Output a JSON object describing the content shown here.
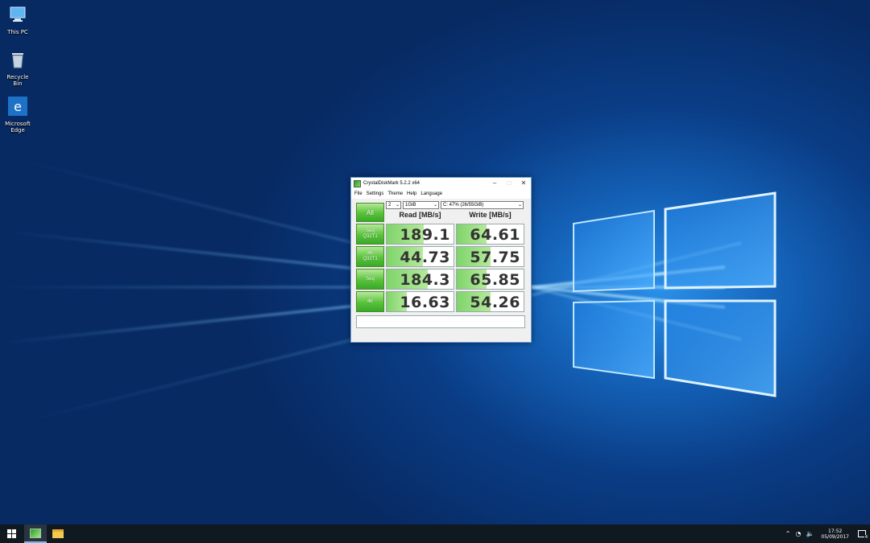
{
  "desktop": {
    "icons": [
      {
        "label": "This PC",
        "icon": "computer-icon"
      },
      {
        "label": "Recycle Bin",
        "icon": "recycle-bin-icon"
      },
      {
        "label": "Microsoft Edge",
        "icon": "edge-icon"
      }
    ]
  },
  "window": {
    "title": "CrystalDiskMark 5.2.2 x64",
    "menu": [
      "File",
      "Settings",
      "Theme",
      "Help",
      "Language"
    ],
    "controls": {
      "count": "2",
      "size": "1GiB",
      "drive": "C: 47% (26/55GiB)"
    },
    "all_button": "All",
    "headers": {
      "read": "Read [MB/s]",
      "write": "Write [MB/s]"
    },
    "rows": [
      {
        "label_line1": "Seq",
        "label_line2": "Q32T1",
        "read": "189.1",
        "write": "64.61",
        "read_fill": 0.55,
        "write_fill": 0.45
      },
      {
        "label_line1": "4K",
        "label_line2": "Q32T1",
        "read": "44.73",
        "write": "57.75",
        "read_fill": 0.54,
        "write_fill": 0.5
      },
      {
        "label_line1": "Seq",
        "label_line2": "",
        "read": "184.3",
        "write": "65.85",
        "read_fill": 0.62,
        "write_fill": 0.45
      },
      {
        "label_line1": "4K",
        "label_line2": "",
        "read": "16.63",
        "write": "54.26",
        "read_fill": 0.3,
        "write_fill": 0.5
      }
    ],
    "accent": "#58c33a"
  },
  "taskbar": {
    "time": "17:52",
    "date": "05/09/2017",
    "notification_count": "4"
  }
}
